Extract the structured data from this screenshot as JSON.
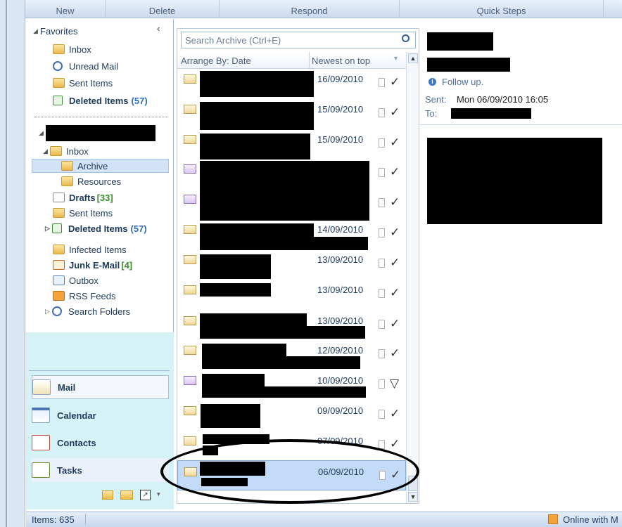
{
  "ribbon": {
    "groups": [
      "New",
      "Delete",
      "Respond",
      "Quick Steps"
    ]
  },
  "nav": {
    "favorites_label": "Favorites",
    "favorites": [
      {
        "label": "Inbox",
        "count": ""
      },
      {
        "label": "Unread Mail",
        "count": ""
      },
      {
        "label": "Sent Items",
        "count": ""
      },
      {
        "label": "Deleted Items",
        "count": "(57)"
      }
    ],
    "folders": [
      {
        "label": "Inbox",
        "count": ""
      },
      {
        "label": "Archive",
        "count": ""
      },
      {
        "label": "Resources",
        "count": ""
      },
      {
        "label": "Drafts",
        "count": "[33]"
      },
      {
        "label": "Sent Items",
        "count": ""
      },
      {
        "label": "Deleted Items",
        "count": "(57)"
      },
      {
        "label": "Infected Items",
        "count": ""
      },
      {
        "label": "Junk E-Mail",
        "count": "[4]"
      },
      {
        "label": "Outbox",
        "count": ""
      },
      {
        "label": "RSS Feeds",
        "count": ""
      },
      {
        "label": "Search Folders",
        "count": ""
      }
    ],
    "buttons": [
      "Mail",
      "Calendar",
      "Contacts",
      "Tasks"
    ]
  },
  "list": {
    "search_placeholder": "Search Archive (Ctrl+E)",
    "arrange_label": "Arrange By: Date",
    "sort_label": "Newest on top",
    "rows": [
      {
        "date": "16/09/2010",
        "check": "✓"
      },
      {
        "date": "15/09/2010",
        "check": "✓"
      },
      {
        "date": "15/09/2010",
        "check": "✓"
      },
      {
        "date": "",
        "check": "✓"
      },
      {
        "date": "",
        "check": "✓"
      },
      {
        "date": "14/09/2010",
        "check": "✓"
      },
      {
        "date": "13/09/2010",
        "check": "✓"
      },
      {
        "date": "13/09/2010",
        "check": "✓"
      },
      {
        "date": "13/09/2010",
        "check": "✓"
      },
      {
        "date": "12/09/2010",
        "check": "✓"
      },
      {
        "date": "10/09/2010",
        "check": "▽"
      },
      {
        "date": "09/09/2010",
        "check": "✓"
      },
      {
        "date": "07/09/2010",
        "check": "✓"
      },
      {
        "date": "06/09/2010",
        "check": "✓"
      }
    ]
  },
  "reading": {
    "follow_up": "Follow up.",
    "sent_label": "Sent:",
    "sent_value": "Mon 06/09/2010 16:05",
    "to_label": "To:"
  },
  "status": {
    "items": "Items: 635",
    "online": "Online with M"
  }
}
